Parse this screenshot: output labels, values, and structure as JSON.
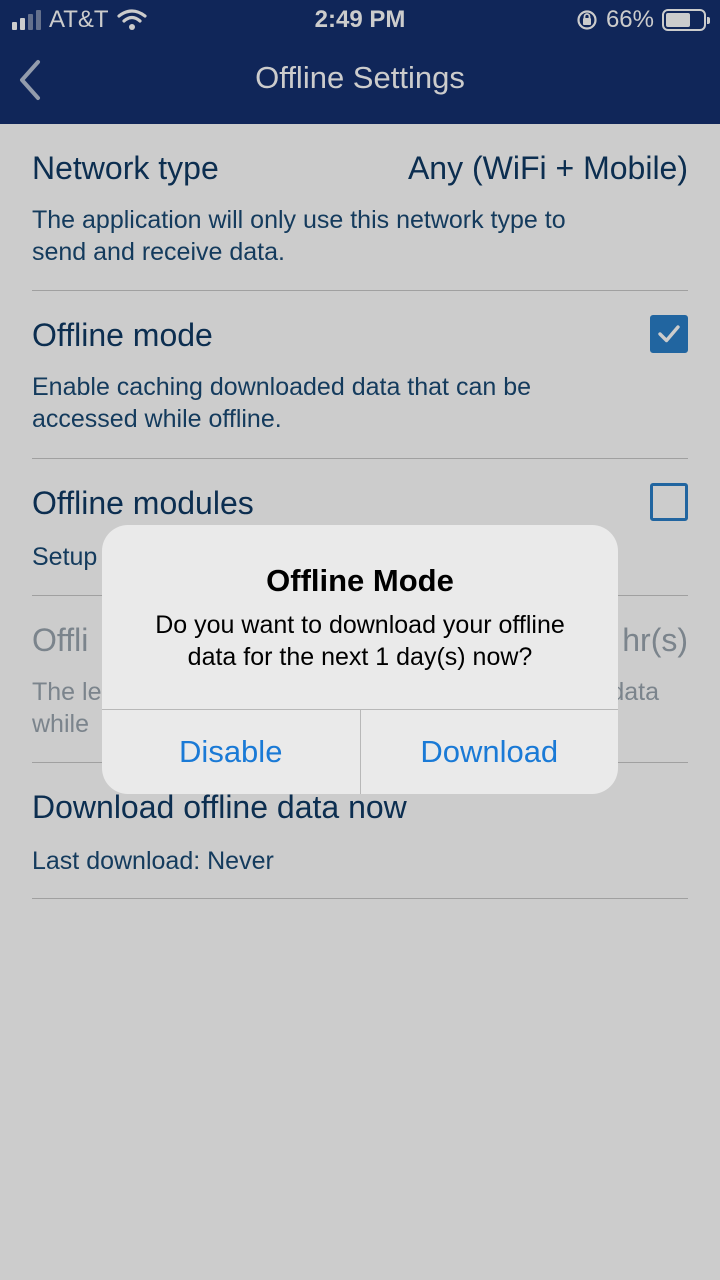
{
  "status_bar": {
    "carrier": "AT&T",
    "time": "2:49 PM",
    "battery_percent": "66%",
    "battery_level": 0.66
  },
  "nav": {
    "title": "Offline Settings",
    "back_icon": "chevron-left-icon"
  },
  "settings": {
    "network_type": {
      "title": "Network type",
      "value": "Any (WiFi + Mobile)",
      "description_line1": "The application will only use this network type to",
      "description_line2": "send and receive data."
    },
    "offline_mode": {
      "title": "Offline mode",
      "checked": true,
      "description_line1": "Enable caching downloaded data that can be",
      "description_line2": "accessed while offline."
    },
    "offline_modules": {
      "title": "Offline modules",
      "checked": false,
      "description": "Setup"
    },
    "offline_period": {
      "title": "Offli",
      "value": "hr(s)",
      "description_line1_start": "The le",
      "description_line1_end": "data",
      "description_line2": "while"
    },
    "download_now": {
      "title": "Download offline data now",
      "description": "Last download: Never"
    }
  },
  "alert": {
    "title": "Offline Mode",
    "message_line1": "Do you want to download your offline",
    "message_line2": "data for the next 1 day(s) now?",
    "disable_label": "Disable",
    "download_label": "Download"
  },
  "colors": {
    "header": "#153070",
    "title_text": "#0f3a64",
    "accent": "#2a7fc8",
    "alert_button": "#1a7ad6"
  }
}
